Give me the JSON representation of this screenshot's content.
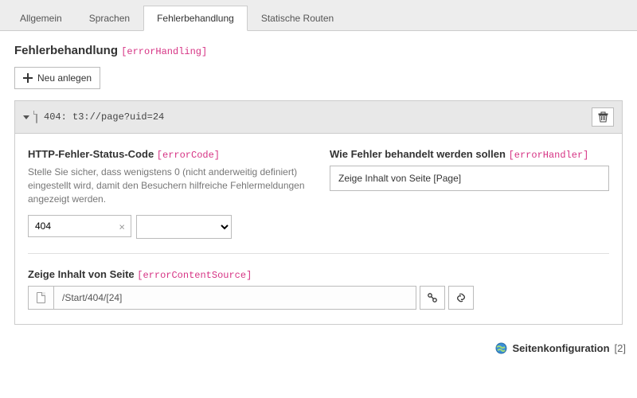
{
  "tabs": {
    "general": "Allgemein",
    "languages": "Sprachen",
    "errorHandling": "Fehlerbehandlung",
    "staticRoutes": "Statische Routen"
  },
  "section": {
    "title": "Fehlerbehandlung",
    "tech": "[errorHandling]",
    "newButton": "Neu anlegen"
  },
  "record": {
    "headerTitle": "404: t3://page?uid=24",
    "errorCode": {
      "label": "HTTP-Fehler-Status-Code",
      "tech": "[errorCode]",
      "help": "Stelle Sie sicher, dass wenigstens 0 (nicht anderweitig definiert) eingestellt wird, damit den Besuchern hilfreiche Fehlermeldungen angezeigt werden.",
      "value": "404",
      "selectValue": ""
    },
    "errorHandler": {
      "label": "Wie Fehler behandelt werden sollen",
      "tech": "[errorHandler]",
      "value": "Zeige Inhalt von Seite [Page]"
    },
    "contentSource": {
      "label": "Zeige Inhalt von Seite",
      "tech": "[errorContentSource]",
      "value": "/Start/404/[24]"
    }
  },
  "footer": {
    "label": "Seitenkonfiguration",
    "count": "[2]"
  }
}
